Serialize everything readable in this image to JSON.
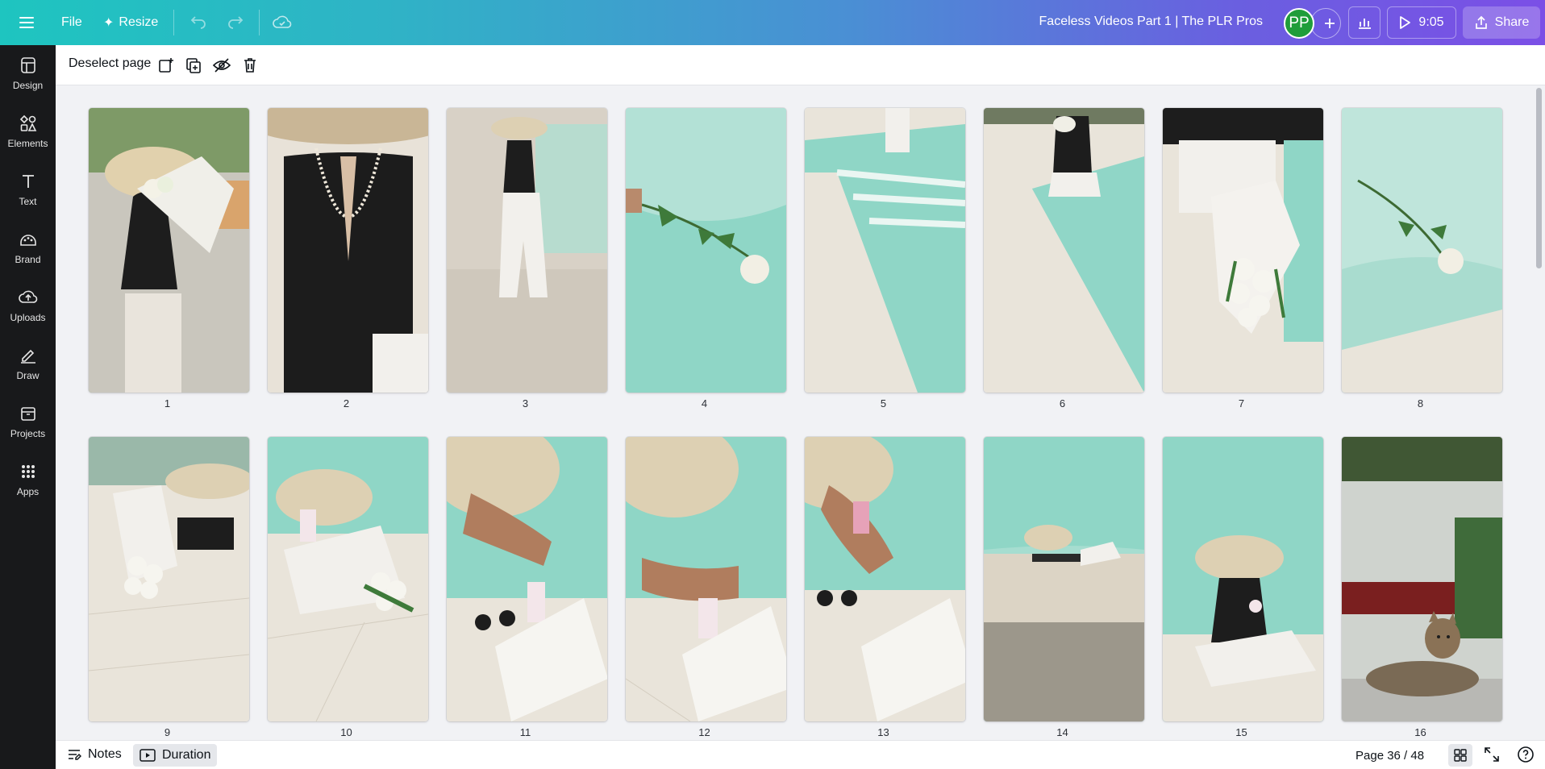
{
  "topbar": {
    "file_label": "File",
    "resize_label": "Resize",
    "doc_title": "Faceless Videos Part 1 | The PLR Pros",
    "avatar_initials": "PP",
    "play_time": "9:05",
    "share_label": "Share"
  },
  "sidebar": {
    "items": [
      {
        "label": "Design",
        "icon": "design-icon"
      },
      {
        "label": "Elements",
        "icon": "elements-icon"
      },
      {
        "label": "Text",
        "icon": "text-icon"
      },
      {
        "label": "Brand",
        "icon": "brand-icon"
      },
      {
        "label": "Uploads",
        "icon": "uploads-icon"
      },
      {
        "label": "Draw",
        "icon": "draw-icon"
      },
      {
        "label": "Projects",
        "icon": "projects-icon"
      },
      {
        "label": "Apps",
        "icon": "apps-icon"
      }
    ]
  },
  "toolbar": {
    "deselect_label": "Deselect page"
  },
  "pages": [
    {
      "num": "1",
      "scene": "woman-hat-bouquet"
    },
    {
      "num": "2",
      "scene": "pearl-necklace-top"
    },
    {
      "num": "3",
      "scene": "woman-seated-poolside"
    },
    {
      "num": "4",
      "scene": "rose-on-water"
    },
    {
      "num": "5",
      "scene": "pool-steps"
    },
    {
      "num": "6",
      "scene": "woman-pool-steps"
    },
    {
      "num": "7",
      "scene": "bouquet-on-edge"
    },
    {
      "num": "8",
      "scene": "rose-floating"
    },
    {
      "num": "9",
      "scene": "hat-bouquet-tiles"
    },
    {
      "num": "10",
      "scene": "hat-glass-bouquet"
    },
    {
      "num": "11",
      "scene": "hat-sunglasses-cartier"
    },
    {
      "num": "12",
      "scene": "hand-glass-cartier"
    },
    {
      "num": "13",
      "scene": "drinking-cartier"
    },
    {
      "num": "14",
      "scene": "woman-lying-poolside"
    },
    {
      "num": "15",
      "scene": "woman-hat-reading"
    },
    {
      "num": "16",
      "scene": "cat-resting"
    }
  ],
  "bottombar": {
    "notes_label": "Notes",
    "duration_label": "Duration",
    "page_indicator": "Page 36 / 48"
  },
  "colors": {
    "accent_green": "#1f9d3a",
    "sidebar_bg": "#18191b",
    "pool_teal": "#8fd6c6"
  }
}
